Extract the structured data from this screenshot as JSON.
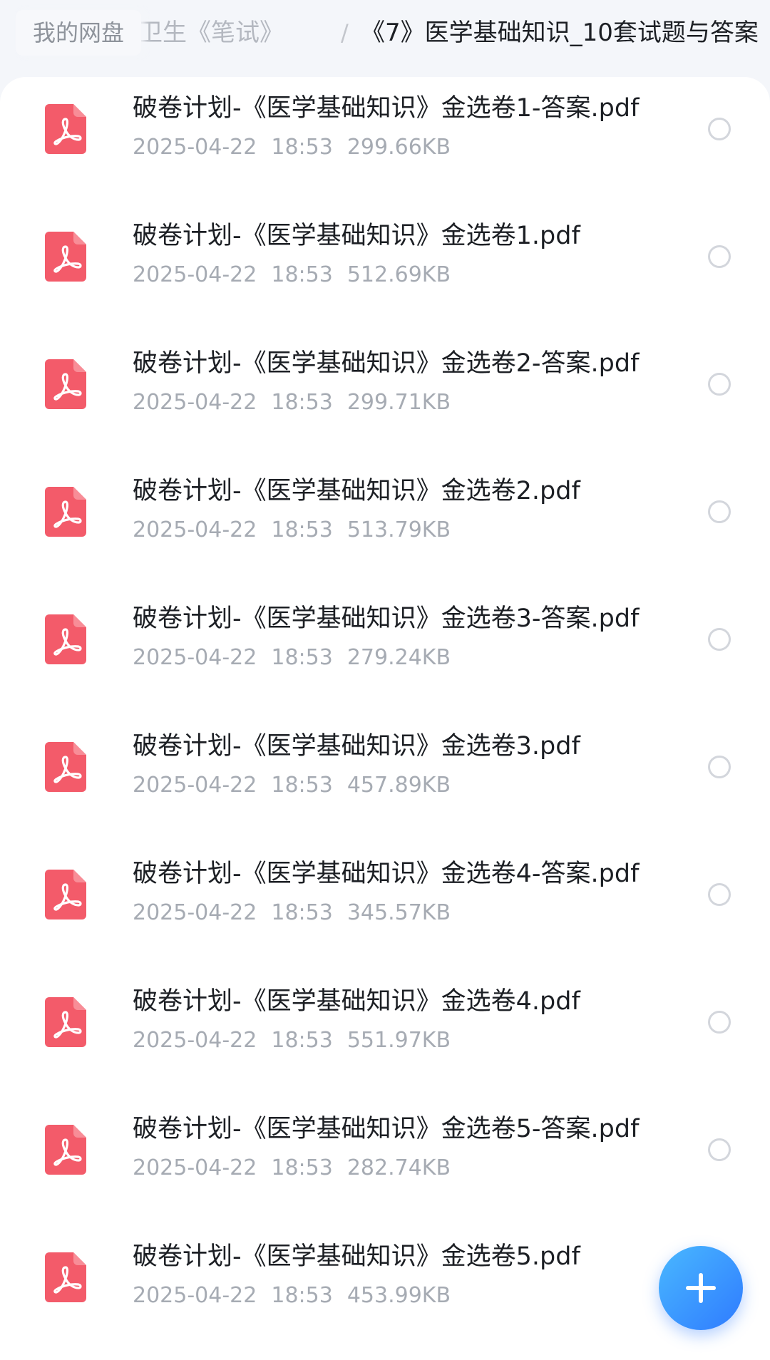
{
  "breadcrumb": {
    "root": "我的网盘",
    "previous": "疗卫生《笔试》",
    "separator": "/",
    "current": "《7》医学基础知识_10套试题与答案"
  },
  "files": [
    {
      "name": "破卷计划-《医学基础知识》金选卷1-答案.pdf",
      "date": "2025-04-22",
      "time": "18:53",
      "size": "299.66KB",
      "icon": "pdf-icon"
    },
    {
      "name": "破卷计划-《医学基础知识》金选卷1.pdf",
      "date": "2025-04-22",
      "time": "18:53",
      "size": "512.69KB",
      "icon": "pdf-icon"
    },
    {
      "name": "破卷计划-《医学基础知识》金选卷2-答案.pdf",
      "date": "2025-04-22",
      "time": "18:53",
      "size": "299.71KB",
      "icon": "pdf-icon"
    },
    {
      "name": "破卷计划-《医学基础知识》金选卷2.pdf",
      "date": "2025-04-22",
      "time": "18:53",
      "size": "513.79KB",
      "icon": "pdf-icon"
    },
    {
      "name": "破卷计划-《医学基础知识》金选卷3-答案.pdf",
      "date": "2025-04-22",
      "time": "18:53",
      "size": "279.24KB",
      "icon": "pdf-icon"
    },
    {
      "name": "破卷计划-《医学基础知识》金选卷3.pdf",
      "date": "2025-04-22",
      "time": "18:53",
      "size": "457.89KB",
      "icon": "pdf-icon"
    },
    {
      "name": "破卷计划-《医学基础知识》金选卷4-答案.pdf",
      "date": "2025-04-22",
      "time": "18:53",
      "size": "345.57KB",
      "icon": "pdf-icon"
    },
    {
      "name": "破卷计划-《医学基础知识》金选卷4.pdf",
      "date": "2025-04-22",
      "time": "18:53",
      "size": "551.97KB",
      "icon": "pdf-icon"
    },
    {
      "name": "破卷计划-《医学基础知识》金选卷5-答案.pdf",
      "date": "2025-04-22",
      "time": "18:53",
      "size": "282.74KB",
      "icon": "pdf-icon"
    },
    {
      "name": "破卷计划-《医学基础知识》金选卷5.pdf",
      "date": "2025-04-22",
      "time": "18:53",
      "size": "453.99KB",
      "icon": "pdf-icon"
    }
  ],
  "fab": {
    "icon": "plus-icon"
  },
  "colors": {
    "pdf_icon": "#f35b6a",
    "fab_start": "#49b8ff",
    "fab_end": "#2f7bff",
    "text_primary": "#1c1f24",
    "text_secondary": "#a6abb3"
  }
}
